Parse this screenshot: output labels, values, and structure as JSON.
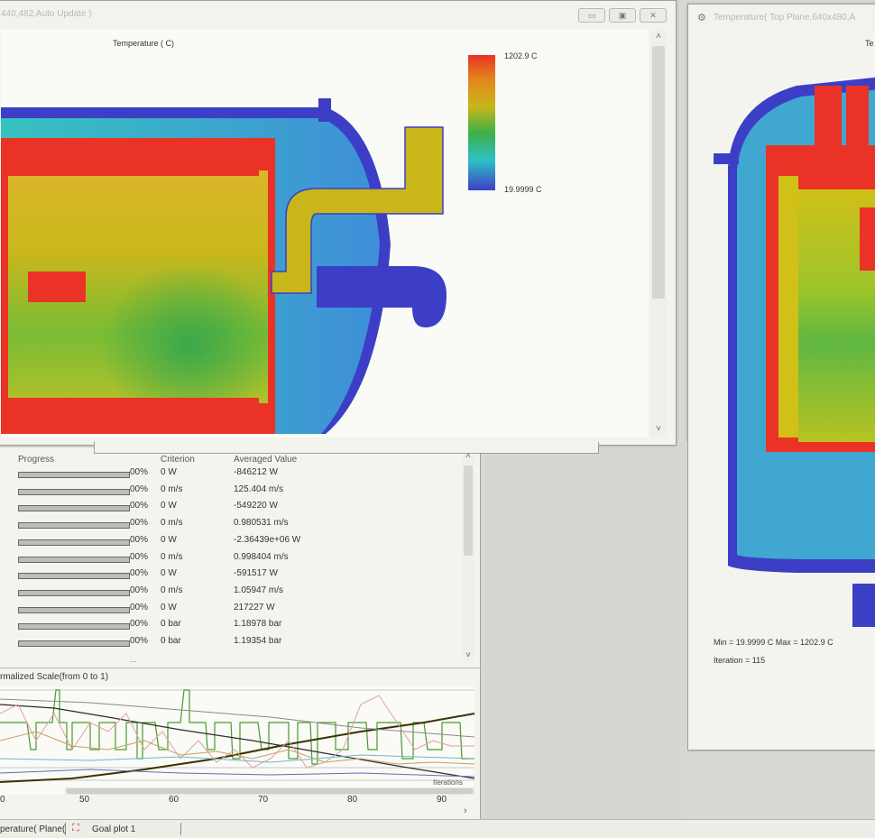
{
  "left_window": {
    "title": "440,482,Auto Update )",
    "buttons": [
      "▭",
      "▣",
      "✕"
    ],
    "plot_title": "Temperature ( C)",
    "legend_max": "1202.9  C",
    "legend_min": "19.9999  C"
  },
  "right_window": {
    "title": "Temperature( Top Plane,640x480,A",
    "plot_title_fragment": "Te",
    "min_max": "Min = 19.9999  C   Max = 1202.9  C",
    "iteration": "Iteration = 115"
  },
  "goals_table": {
    "columns": [
      "Progress",
      "Criterion",
      "Averaged Value"
    ],
    "rows": [
      {
        "progress": 100,
        "pct": "00%",
        "criterion": "0 W",
        "value": "-846212 W"
      },
      {
        "progress": 100,
        "pct": "00%",
        "criterion": "0 m/s",
        "value": "125.404 m/s"
      },
      {
        "progress": 100,
        "pct": "00%",
        "criterion": "0 W",
        "value": "-549220 W"
      },
      {
        "progress": 100,
        "pct": "00%",
        "criterion": "0 m/s",
        "value": "0.980531 m/s"
      },
      {
        "progress": 100,
        "pct": "00%",
        "criterion": "0 W",
        "value": "-2.36439e+06 W"
      },
      {
        "progress": 100,
        "pct": "00%",
        "criterion": "0 m/s",
        "value": "0.998404 m/s"
      },
      {
        "progress": 100,
        "pct": "00%",
        "criterion": "0 W",
        "value": "-591517 W"
      },
      {
        "progress": 100,
        "pct": "00%",
        "criterion": "0 m/s",
        "value": "1.05947 m/s"
      },
      {
        "progress": 100,
        "pct": "00%",
        "criterion": "0 W",
        "value": "217227 W"
      },
      {
        "progress": 100,
        "pct": "00%",
        "criterion": "0 bar",
        "value": "1.18978 bar"
      },
      {
        "progress": 100,
        "pct": "00%",
        "criterion": "0 bar",
        "value": "1.19354 bar"
      }
    ],
    "ellipsis": "..."
  },
  "goal_plot": {
    "title": "rmalized Scale(from 0 to 1)",
    "x_ticks": [
      "0",
      "50",
      "60",
      "70",
      "80",
      "90"
    ],
    "iterations_label": "Iterations"
  },
  "bottom_tabs": [
    {
      "label": "perature( Plane("
    },
    {
      "label": "Goal plot 1"
    }
  ],
  "colors": {
    "hot": "#ea3326",
    "warm": "#c8b61a",
    "mid": "#3db04a",
    "cool": "#2fc0c6",
    "cold": "#3c3fc6"
  }
}
